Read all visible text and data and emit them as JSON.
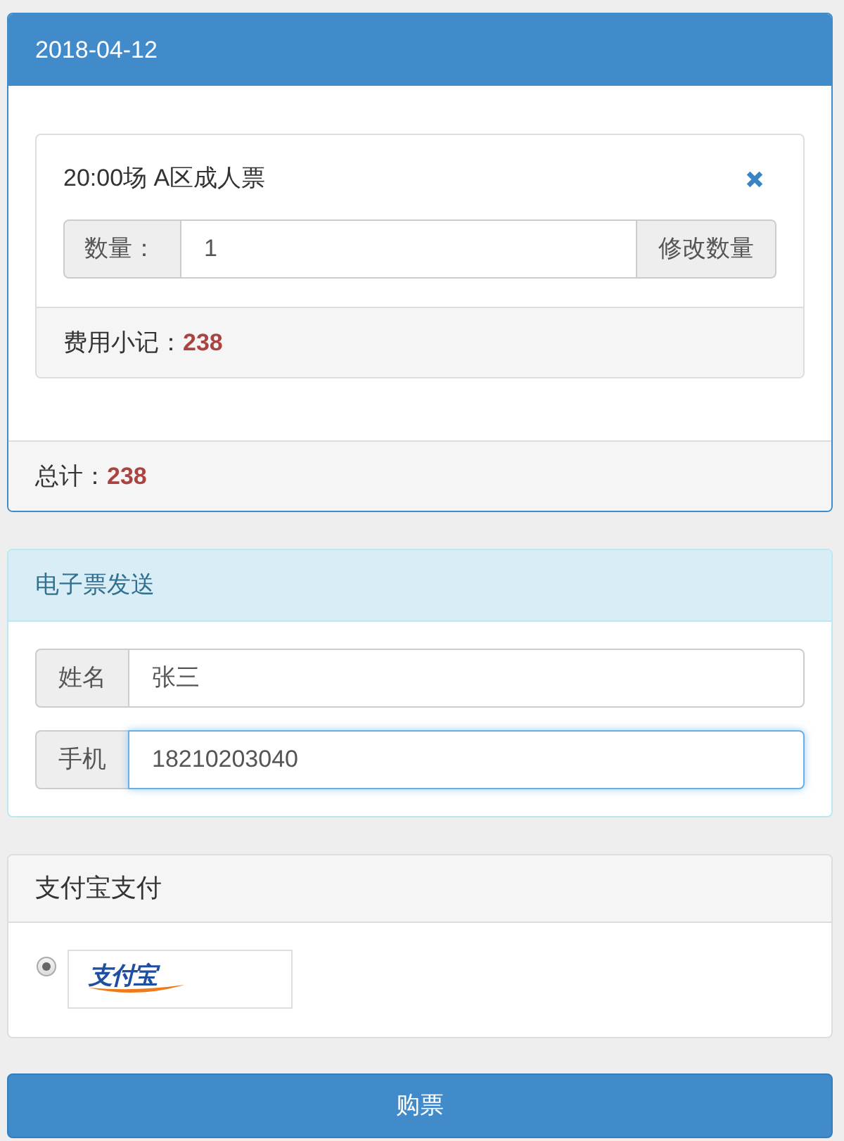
{
  "order_panel": {
    "date": "2018-04-12",
    "items": [
      {
        "title": "20:00场 A区成人票",
        "quantity_label": "数量：",
        "quantity": "1",
        "update_button": "修改数量",
        "subtotal_label": "费用小记：",
        "subtotal": "238"
      }
    ],
    "total_label": "总计：",
    "total": "238"
  },
  "eticket_panel": {
    "title": "电子票发送",
    "fields": [
      {
        "label": "姓名",
        "value": "张三",
        "focused": false
      },
      {
        "label": "手机",
        "value": "18210203040",
        "focused": true
      }
    ]
  },
  "payment_panel": {
    "title": "支付宝支付",
    "options": [
      {
        "logo_text": "支付宝",
        "selected": true
      }
    ]
  },
  "buy_button": "购票"
}
